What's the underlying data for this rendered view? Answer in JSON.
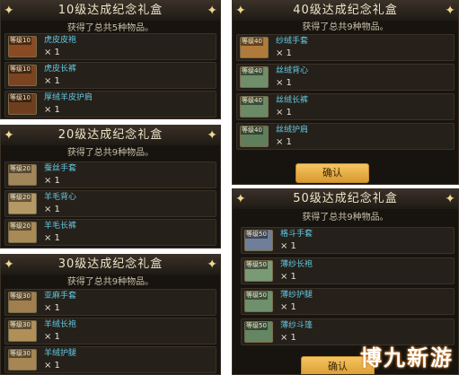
{
  "qty": "× 1",
  "panels": {
    "lv10": {
      "title": "10级达成纪念礼盒",
      "subtitle": "获得了总共5种物品。",
      "items": [
        {
          "level": "等级10",
          "name": "虎皮皮袍",
          "icon": "leather-robe-icon",
          "color": "#8a4a22"
        },
        {
          "level": "等级10",
          "name": "虎皮长裤",
          "icon": "leather-pants-icon",
          "color": "#7a4420"
        },
        {
          "level": "等级10",
          "name": "厚绒羊皮护肩",
          "icon": "sheepskin-shoulder-icon",
          "color": "#6e3e1e"
        }
      ]
    },
    "lv20": {
      "title": "20级达成纪念礼盒",
      "subtitle": "获得了总共9种物品。",
      "items": [
        {
          "level": "等级20",
          "name": "蚕丝手套",
          "icon": "silk-gloves-icon",
          "color": "#a08658"
        },
        {
          "level": "等级20",
          "name": "羊毛背心",
          "icon": "wool-vest-icon",
          "color": "#b49866"
        },
        {
          "level": "等级20",
          "name": "羊毛长裤",
          "icon": "wool-pants-icon",
          "color": "#a88a56"
        }
      ]
    },
    "lv30": {
      "title": "30级达成纪念礼盒",
      "subtitle": "获得了总共9种物品。",
      "items": [
        {
          "level": "等级30",
          "name": "亚麻手套",
          "icon": "linen-gloves-icon",
          "color": "#a07e4e"
        },
        {
          "level": "等级30",
          "name": "羊绒长袍",
          "icon": "cashmere-robe-icon",
          "color": "#b09058"
        },
        {
          "level": "等级30",
          "name": "羊绒护腿",
          "icon": "cashmere-leggings-icon",
          "color": "#a68652"
        }
      ]
    },
    "lv40": {
      "title": "40级达成纪念礼盒",
      "subtitle": "获得了总共9种物品。",
      "items": [
        {
          "level": "等级40",
          "name": "纱绒手套",
          "icon": "yarn-gloves-icon",
          "color": "#b07a3a"
        },
        {
          "level": "等级40",
          "name": "丝绒背心",
          "icon": "velvet-vest-icon",
          "color": "#6f8f6a"
        },
        {
          "level": "等级40",
          "name": "丝绒长裤",
          "icon": "velvet-pants-icon",
          "color": "#6a8a68"
        },
        {
          "level": "等级40",
          "name": "丝绒护肩",
          "icon": "velvet-shoulder-icon",
          "color": "#5e7e5c"
        }
      ],
      "button": "确认"
    },
    "lv50": {
      "title": "50级达成纪念礼盒",
      "subtitle": "获得了总共9种物品。",
      "items": [
        {
          "level": "等级50",
          "name": "格斗手套",
          "icon": "fighting-gloves-icon",
          "color": "#6f7f9a"
        },
        {
          "level": "等级50",
          "name": "薄纱长袍",
          "icon": "gauze-robe-icon",
          "color": "#7a9a76"
        },
        {
          "level": "等级50",
          "name": "薄纱护腿",
          "icon": "gauze-leggings-icon",
          "color": "#6e906c"
        },
        {
          "level": "等级50",
          "name": "薄纱斗篷",
          "icon": "gauze-cloak-icon",
          "color": "#648662"
        }
      ],
      "button": "确认"
    }
  },
  "watermark": "博九新游"
}
